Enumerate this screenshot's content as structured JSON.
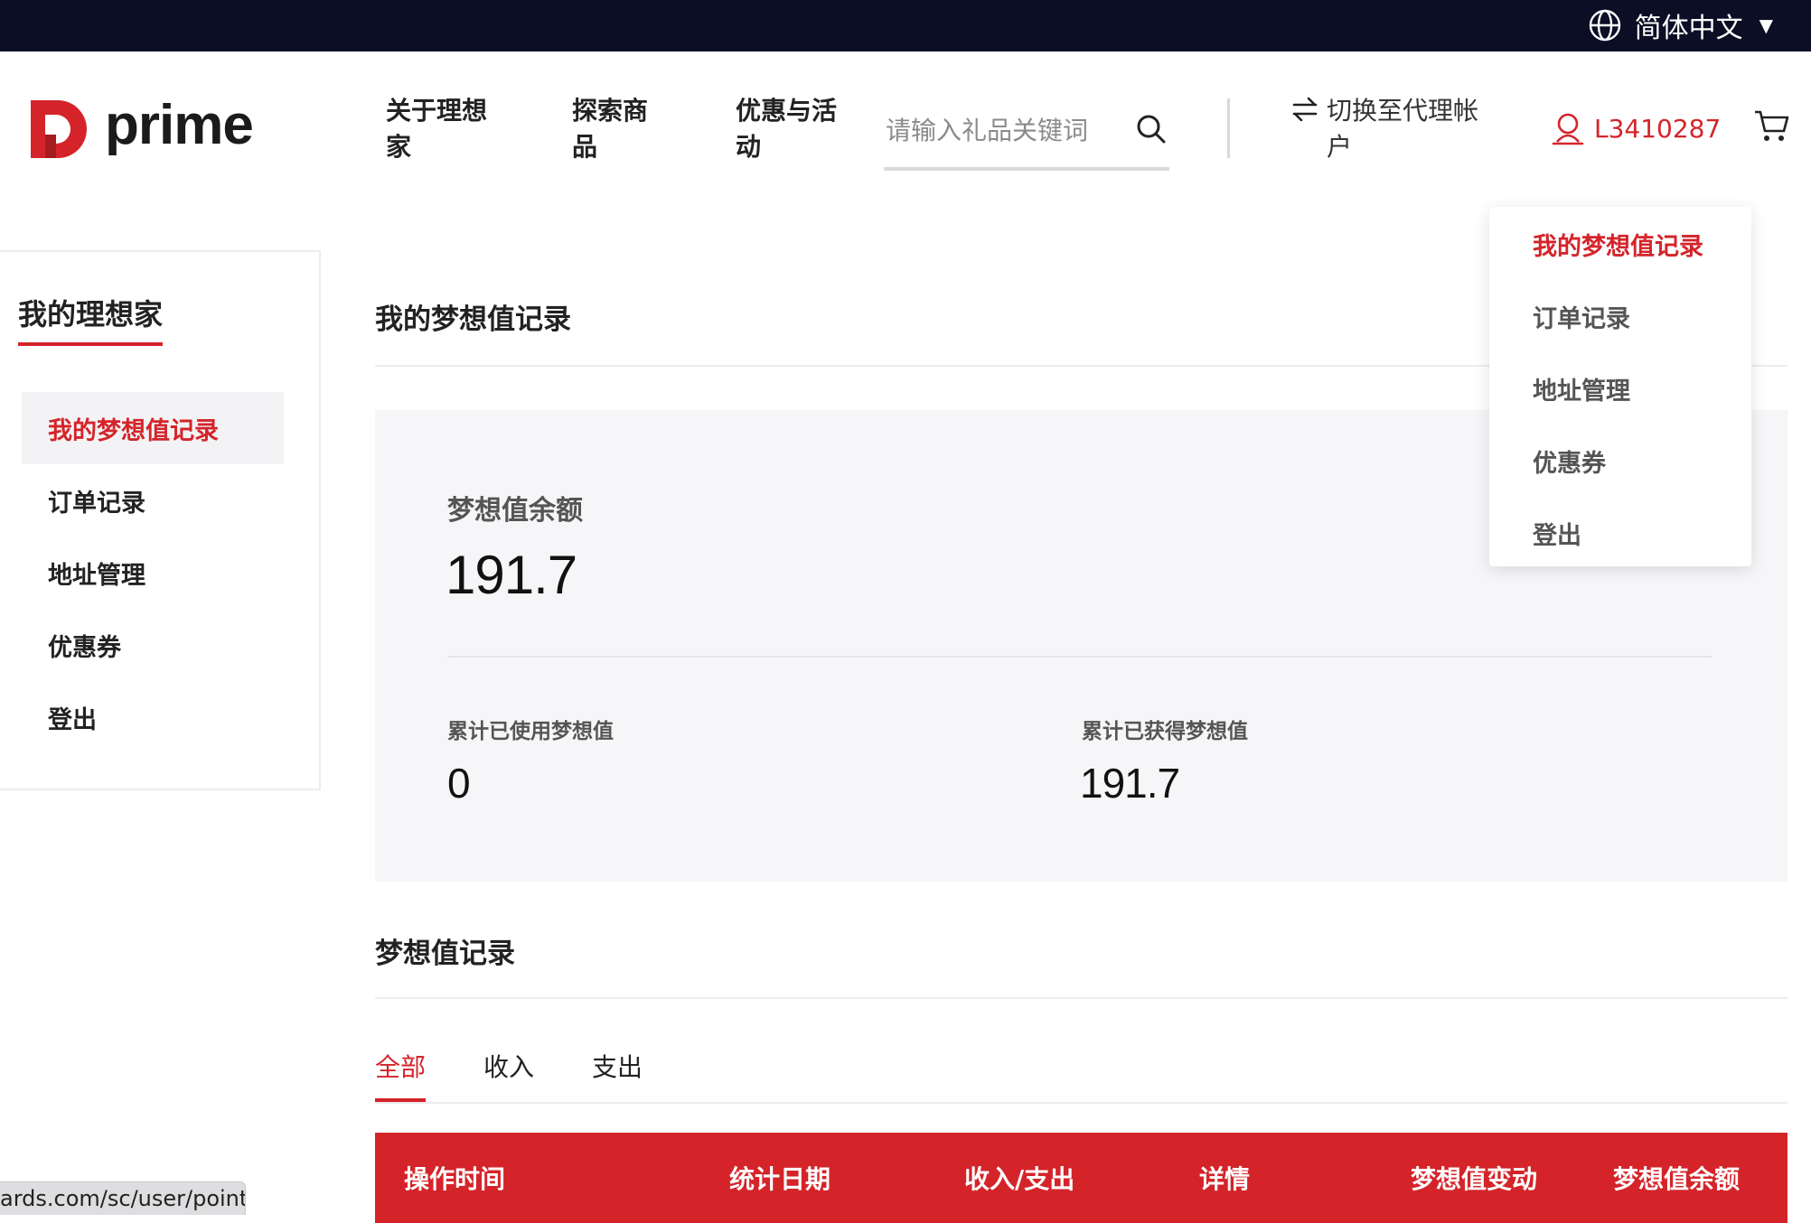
{
  "top_bar": {
    "language": "简体中文"
  },
  "header": {
    "logo_text": "prime",
    "nav": [
      "关于理想\n家",
      "探索商\n品",
      "优惠与活\n动"
    ],
    "search_placeholder": "请输入礼品关键词",
    "switch_account": "切换至代理帐\n户",
    "username": "L3410287"
  },
  "sidebar": {
    "title": "我的理想家",
    "items": [
      "我的梦想值记录",
      "订单记录",
      "地址管理",
      "优惠券",
      "登出"
    ]
  },
  "main": {
    "title": "我的梦想值记录",
    "balance_label": "梦想值余额",
    "balance_value": "191.7",
    "used_label": "累计已使用梦想值",
    "used_value": "0",
    "earned_label": "累计已获得梦想值",
    "earned_value": "191.7",
    "records_title": "梦想值记录",
    "tabs": [
      "全部",
      "收入",
      "支出"
    ],
    "table_headers": [
      "操作时间",
      "统计日期",
      "收入/支出",
      "详情",
      "梦想值变动",
      "梦想值余额"
    ]
  },
  "dropdown": {
    "items": [
      "我的梦想值记录",
      "订单记录",
      "地址管理",
      "优惠券",
      "登出"
    ]
  },
  "status_url": "ards.com/sc/user/points",
  "colors": {
    "accent": "#d4242a",
    "top_bar": "#0b0e24",
    "card_bg": "#f6f6f8"
  }
}
